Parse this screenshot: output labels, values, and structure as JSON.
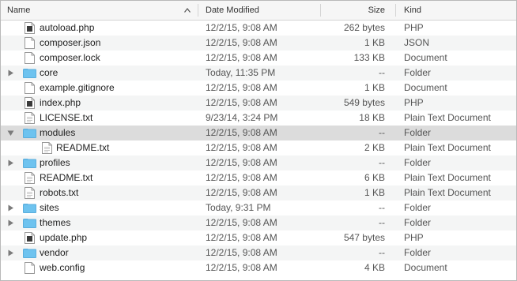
{
  "columns": {
    "name": "Name",
    "date_modified": "Date Modified",
    "size": "Size",
    "kind": "Kind"
  },
  "colors": {
    "folder": "#6ec3ef",
    "selected_row": "#dcdcdc",
    "alt_row": "#f4f5f5"
  },
  "rows": [
    {
      "name": "autoload.php",
      "date": "12/2/15, 9:08 AM",
      "size": "262 bytes",
      "kind": "PHP",
      "icon": "php-file-icon"
    },
    {
      "name": "composer.json",
      "date": "12/2/15, 9:08 AM",
      "size": "1 KB",
      "kind": "JSON",
      "icon": "document-icon"
    },
    {
      "name": "composer.lock",
      "date": "12/2/15, 9:08 AM",
      "size": "133 KB",
      "kind": "Document",
      "icon": "document-icon"
    },
    {
      "name": "core",
      "date": "Today, 11:35 PM",
      "size": "--",
      "kind": "Folder",
      "icon": "folder-icon"
    },
    {
      "name": "example.gitignore",
      "date": "12/2/15, 9:08 AM",
      "size": "1 KB",
      "kind": "Document",
      "icon": "document-icon"
    },
    {
      "name": "index.php",
      "date": "12/2/15, 9:08 AM",
      "size": "549 bytes",
      "kind": "PHP",
      "icon": "php-file-icon"
    },
    {
      "name": "LICENSE.txt",
      "date": "9/23/14, 3:24 PM",
      "size": "18 KB",
      "kind": "Plain Text Document",
      "icon": "text-file-icon"
    },
    {
      "name": "modules",
      "date": "12/2/15, 9:08 AM",
      "size": "--",
      "kind": "Folder",
      "icon": "folder-icon"
    },
    {
      "name": "README.txt",
      "date": "12/2/15, 9:08 AM",
      "size": "2 KB",
      "kind": "Plain Text Document",
      "icon": "text-file-icon"
    },
    {
      "name": "profiles",
      "date": "12/2/15, 9:08 AM",
      "size": "--",
      "kind": "Folder",
      "icon": "folder-icon"
    },
    {
      "name": "README.txt",
      "date": "12/2/15, 9:08 AM",
      "size": "6 KB",
      "kind": "Plain Text Document",
      "icon": "text-file-icon"
    },
    {
      "name": "robots.txt",
      "date": "12/2/15, 9:08 AM",
      "size": "1 KB",
      "kind": "Plain Text Document",
      "icon": "text-file-icon"
    },
    {
      "name": "sites",
      "date": "Today, 9:31 PM",
      "size": "--",
      "kind": "Folder",
      "icon": "folder-icon"
    },
    {
      "name": "themes",
      "date": "12/2/15, 9:08 AM",
      "size": "--",
      "kind": "Folder",
      "icon": "folder-icon"
    },
    {
      "name": "update.php",
      "date": "12/2/15, 9:08 AM",
      "size": "547 bytes",
      "kind": "PHP",
      "icon": "php-file-icon"
    },
    {
      "name": "vendor",
      "date": "12/2/15, 9:08 AM",
      "size": "--",
      "kind": "Folder",
      "icon": "folder-icon"
    },
    {
      "name": "web.config",
      "date": "12/2/15, 9:08 AM",
      "size": "4 KB",
      "kind": "Document",
      "icon": "document-icon"
    }
  ]
}
